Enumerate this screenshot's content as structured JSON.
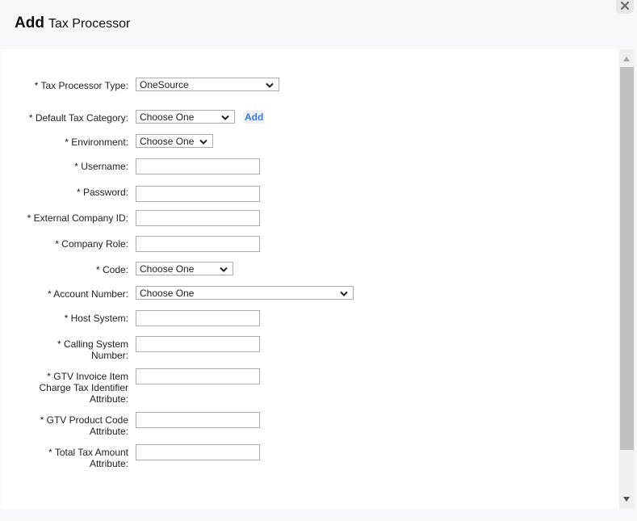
{
  "dialog": {
    "title_bold": "Add",
    "title_rest": "Tax Processor",
    "close_icon": "close-x-icon"
  },
  "form": {
    "tax_processor_type": {
      "label": "* Tax Processor Type:",
      "value": "OneSource"
    },
    "default_tax_category": {
      "label": "* Default Tax Category:",
      "value": "Choose One",
      "add_label": "Add"
    },
    "environment": {
      "label": "* Environment:",
      "value": "Choose One"
    },
    "username": {
      "label": "* Username:",
      "value": ""
    },
    "password": {
      "label": "* Password:",
      "value": ""
    },
    "external_company_id": {
      "label": "* External Company ID:",
      "value": ""
    },
    "company_role": {
      "label": "* Company Role:",
      "value": ""
    },
    "code": {
      "label": "* Code:",
      "value": "Choose One"
    },
    "account_number": {
      "label": "* Account Number:",
      "value": "Choose One"
    },
    "host_system": {
      "label": "* Host System:",
      "value": ""
    },
    "calling_system_number": {
      "label_line1": "* Calling System",
      "label_line2": "Number:",
      "value": ""
    },
    "gtv_invoice_item": {
      "label_line1": "* GTV Invoice Item",
      "label_line2": "Charge Tax Identifier",
      "label_line3": "Attribute:",
      "value": ""
    },
    "gtv_product_code": {
      "label_line1": "* GTV Product Code",
      "label_line2": "Attribute:",
      "value": ""
    },
    "total_tax_amount": {
      "label_line1": "* Total Tax Amount",
      "label_line2": "Attribute:",
      "value": ""
    }
  },
  "colors": {
    "link": "#3a7bd5",
    "header_bg": "#f7f8fa",
    "input_border": "#a8acb3"
  }
}
